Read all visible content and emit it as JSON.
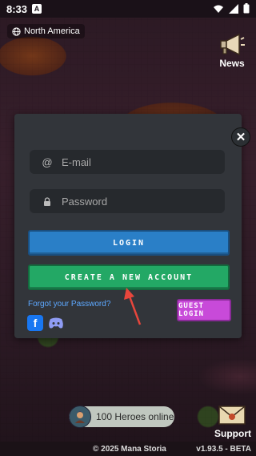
{
  "status_bar": {
    "time": "8:33",
    "notification_letter": "A"
  },
  "region": {
    "label": "North America"
  },
  "news": {
    "label": "News"
  },
  "dialog": {
    "email_placeholder": "E-mail",
    "email_value": "",
    "password_placeholder": "Password",
    "password_value": "",
    "login_label": "LOGIN",
    "create_label": "CREATE A NEW ACCOUNT",
    "forgot_label": "Forgot your Password?",
    "guest_label": "GUEST LOGIN",
    "close_symbol": "✕"
  },
  "online": {
    "text": "100 Heroes online"
  },
  "support": {
    "label": "Support"
  },
  "footer": {
    "copyright": "© 2025 Mana Storia",
    "version": "v1.93.5 - BETA"
  },
  "colors": {
    "login_button": "#2a7fc7",
    "create_button": "#23a865",
    "guest_button": "#c84ad9",
    "link": "#5da8ff",
    "annotation_arrow": "#e8463c"
  },
  "icons": [
    "globe-icon",
    "megaphone-icon",
    "at-icon",
    "lock-icon",
    "facebook-icon",
    "discord-icon",
    "envelope-icon",
    "close-icon",
    "wifi-icon",
    "signal-icon",
    "battery-icon"
  ]
}
